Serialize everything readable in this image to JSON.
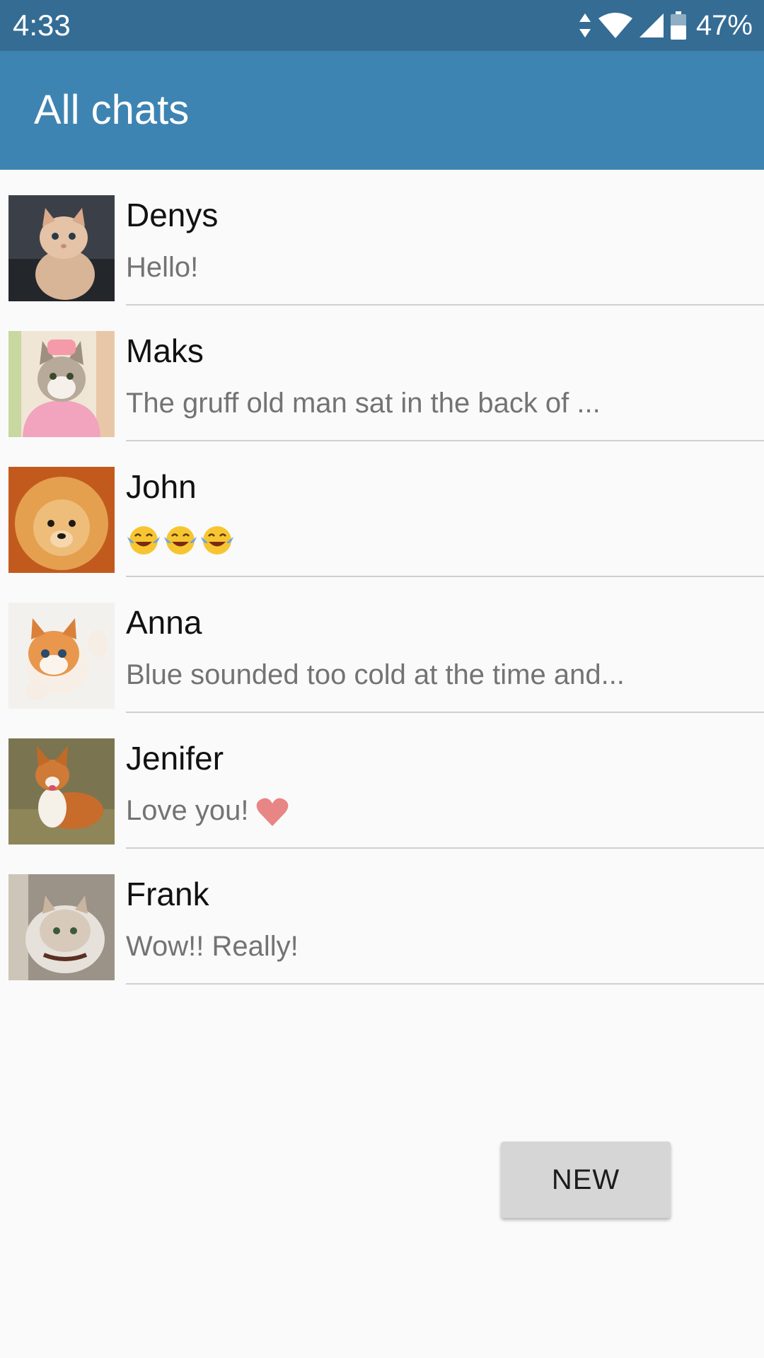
{
  "status_bar": {
    "time": "4:33",
    "battery": "47%",
    "icons": [
      "data-transfer-icon",
      "wifi-icon",
      "signal-icon",
      "battery-icon"
    ]
  },
  "app_bar": {
    "title": "All chats",
    "color": "#3e84b2"
  },
  "chats": [
    {
      "name": "Denys",
      "message": "Hello!",
      "avatar": "kitten-avatar"
    },
    {
      "name": "Maks",
      "message": "The gruff old man sat in the back of ...",
      "avatar": "cat-in-pink-sweater-avatar"
    },
    {
      "name": "John",
      "message": "",
      "avatar": "pomeranian-avatar",
      "emoji": [
        "laughing-tears-emoji",
        "laughing-tears-emoji",
        "laughing-tears-emoji"
      ]
    },
    {
      "name": "Anna",
      "message": "Blue sounded too cold at the time and...",
      "avatar": "kitten-waving-avatar"
    },
    {
      "name": "Jenifer",
      "message": "Love you!",
      "avatar": "corgi-avatar",
      "trailing_icon": "heart-icon"
    },
    {
      "name": "Frank",
      "message": "Wow!! Really!",
      "avatar": "fluffy-cat-avatar"
    }
  ],
  "fab": {
    "label": "NEW"
  }
}
